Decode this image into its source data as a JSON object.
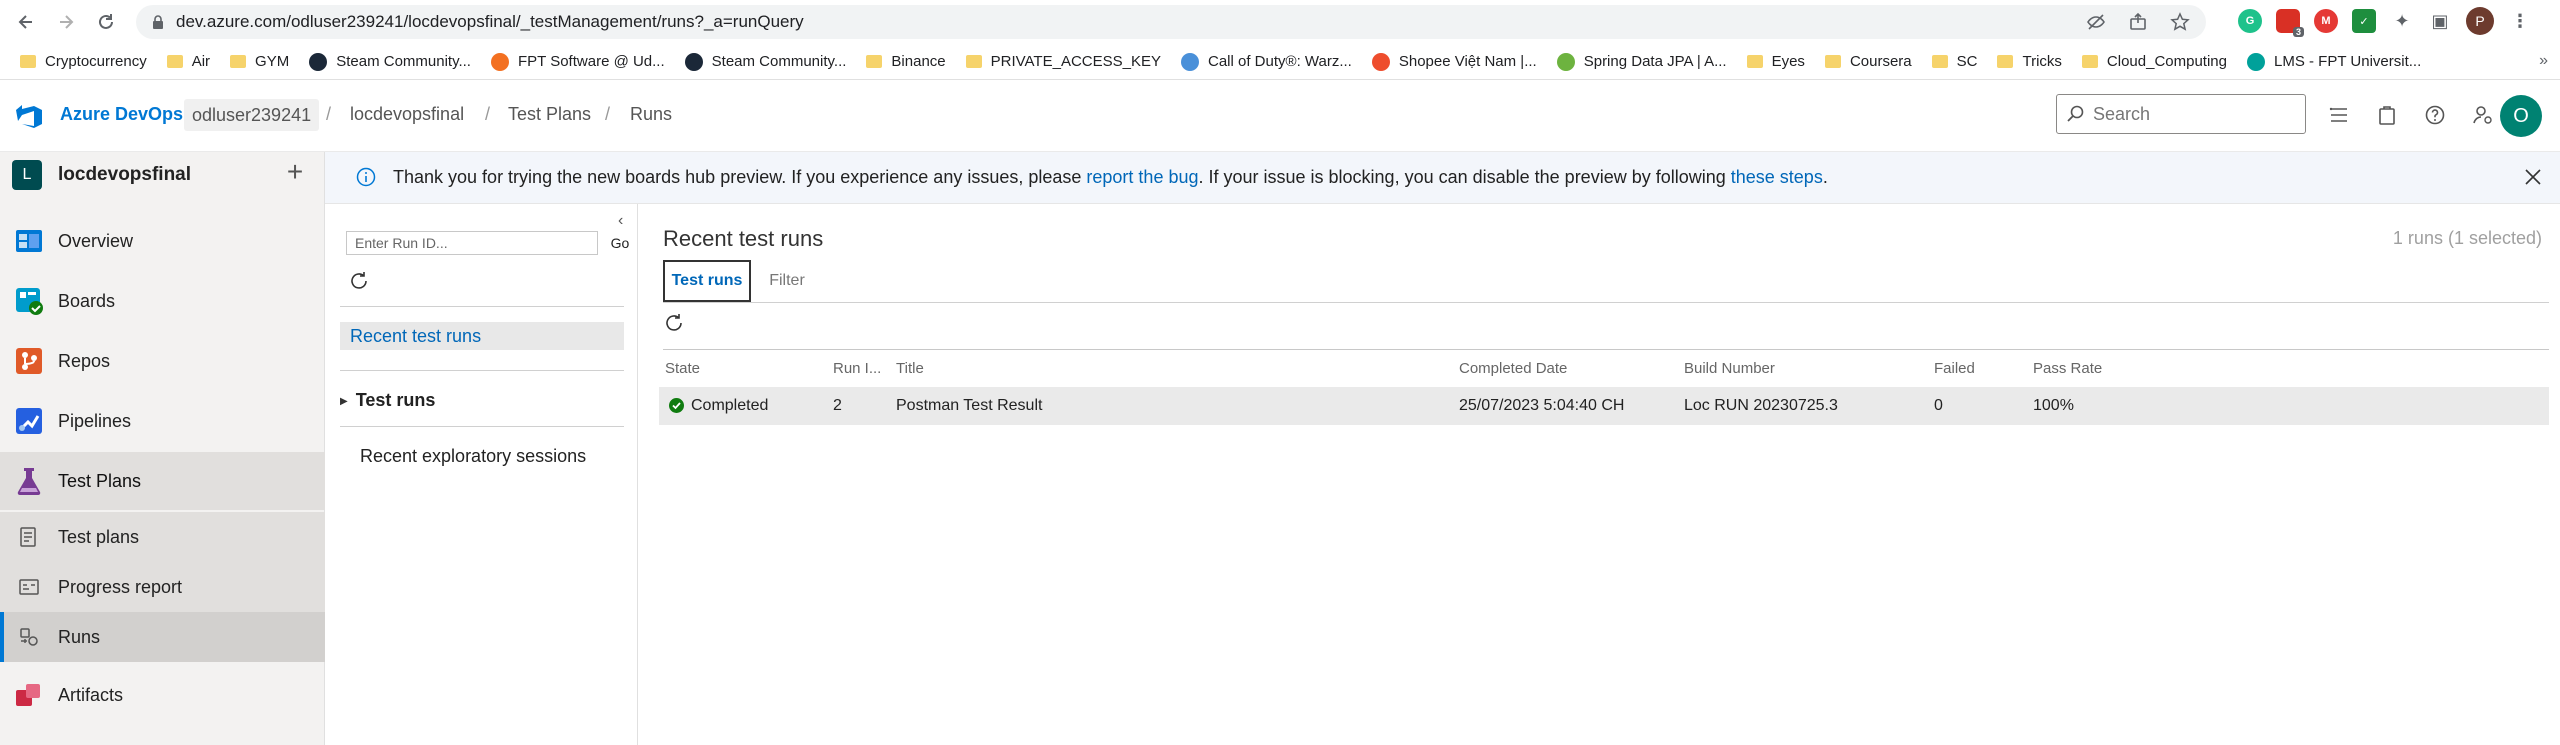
{
  "browser": {
    "url": "dev.azure.com/odluser239241/locdevopsfinal/_testManagement/runs?_a=runQuery",
    "bookmarks": [
      {
        "label": "Cryptocurrency",
        "icon": "folder-icon"
      },
      {
        "label": "Air",
        "icon": "folder-icon"
      },
      {
        "label": "GYM",
        "icon": "folder-icon"
      },
      {
        "label": "Steam Community...",
        "icon": "steam-icon"
      },
      {
        "label": "FPT Software @ Ud...",
        "icon": "fpt-icon"
      },
      {
        "label": "Steam Community...",
        "icon": "steam-icon"
      },
      {
        "label": "Binance",
        "icon": "folder-icon"
      },
      {
        "label": "PRIVATE_ACCESS_KEY",
        "icon": "folder-icon"
      },
      {
        "label": "Call of Duty®: Warz...",
        "icon": "cod-icon"
      },
      {
        "label": "Shopee Việt Nam |...",
        "icon": "shopee-icon"
      },
      {
        "label": "Spring Data JPA | A...",
        "icon": "spring-icon"
      },
      {
        "label": "Eyes",
        "icon": "folder-icon"
      },
      {
        "label": "Coursera",
        "icon": "folder-icon"
      },
      {
        "label": "SC",
        "icon": "folder-icon"
      },
      {
        "label": "Tricks",
        "icon": "folder-icon"
      },
      {
        "label": "Cloud_Computing",
        "icon": "folder-icon"
      },
      {
        "label": "LMS - FPT Universit...",
        "icon": "lms-icon"
      }
    ],
    "profile_initial": "P",
    "ext_badge": "3"
  },
  "header": {
    "brand": "Azure DevOps",
    "org": "odluser239241",
    "breadcrumbs": [
      "locdevopsfinal",
      "Test Plans",
      "Runs"
    ],
    "search_placeholder": "Search",
    "user_initial": "O"
  },
  "sidebar": {
    "project_initial": "L",
    "project_name": "locdevopsfinal",
    "items": [
      {
        "label": "Overview",
        "icon": "overview-icon"
      },
      {
        "label": "Boards",
        "icon": "boards-icon"
      },
      {
        "label": "Repos",
        "icon": "repos-icon"
      },
      {
        "label": "Pipelines",
        "icon": "pipelines-icon"
      },
      {
        "label": "Test Plans",
        "icon": "test-plans-icon"
      },
      {
        "label": "Artifacts",
        "icon": "artifacts-icon"
      }
    ],
    "sub_items": [
      {
        "label": "Test plans",
        "icon": "test-plans-list-icon"
      },
      {
        "label": "Progress report",
        "icon": "progress-report-icon"
      },
      {
        "label": "Runs",
        "icon": "runs-icon"
      }
    ]
  },
  "banner": {
    "text_1": "Thank you for trying the new boards hub preview. If you experience any issues, please ",
    "link_1": "report the bug",
    "text_2": ". If your issue is blocking, you can disable the preview by following ",
    "link_2": "these steps",
    "text_3": "."
  },
  "midpanel": {
    "runid_placeholder": "Enter Run ID...",
    "go_label": "Go",
    "recent_test_runs": "Recent test runs",
    "test_runs": "Test runs",
    "recent_exploratory": "Recent exploratory sessions"
  },
  "main": {
    "title": "Recent test runs",
    "count": "1 runs (1 selected)",
    "tabs": [
      "Test runs",
      "Filter"
    ],
    "columns": [
      "State",
      "Run I...",
      "Title",
      "Completed Date",
      "Build Number",
      "Failed",
      "Pass Rate"
    ],
    "rows": [
      {
        "state": "Completed",
        "run_id": "2",
        "title": "Postman Test Result",
        "completed_date": "25/07/2023 5:04:40 CH",
        "build_number": "Loc RUN 20230725.3",
        "failed": "0",
        "pass_rate": "100%"
      }
    ]
  },
  "colors": {
    "accent": "#0078d4",
    "success": "#107c10",
    "avatar": "#008272"
  }
}
